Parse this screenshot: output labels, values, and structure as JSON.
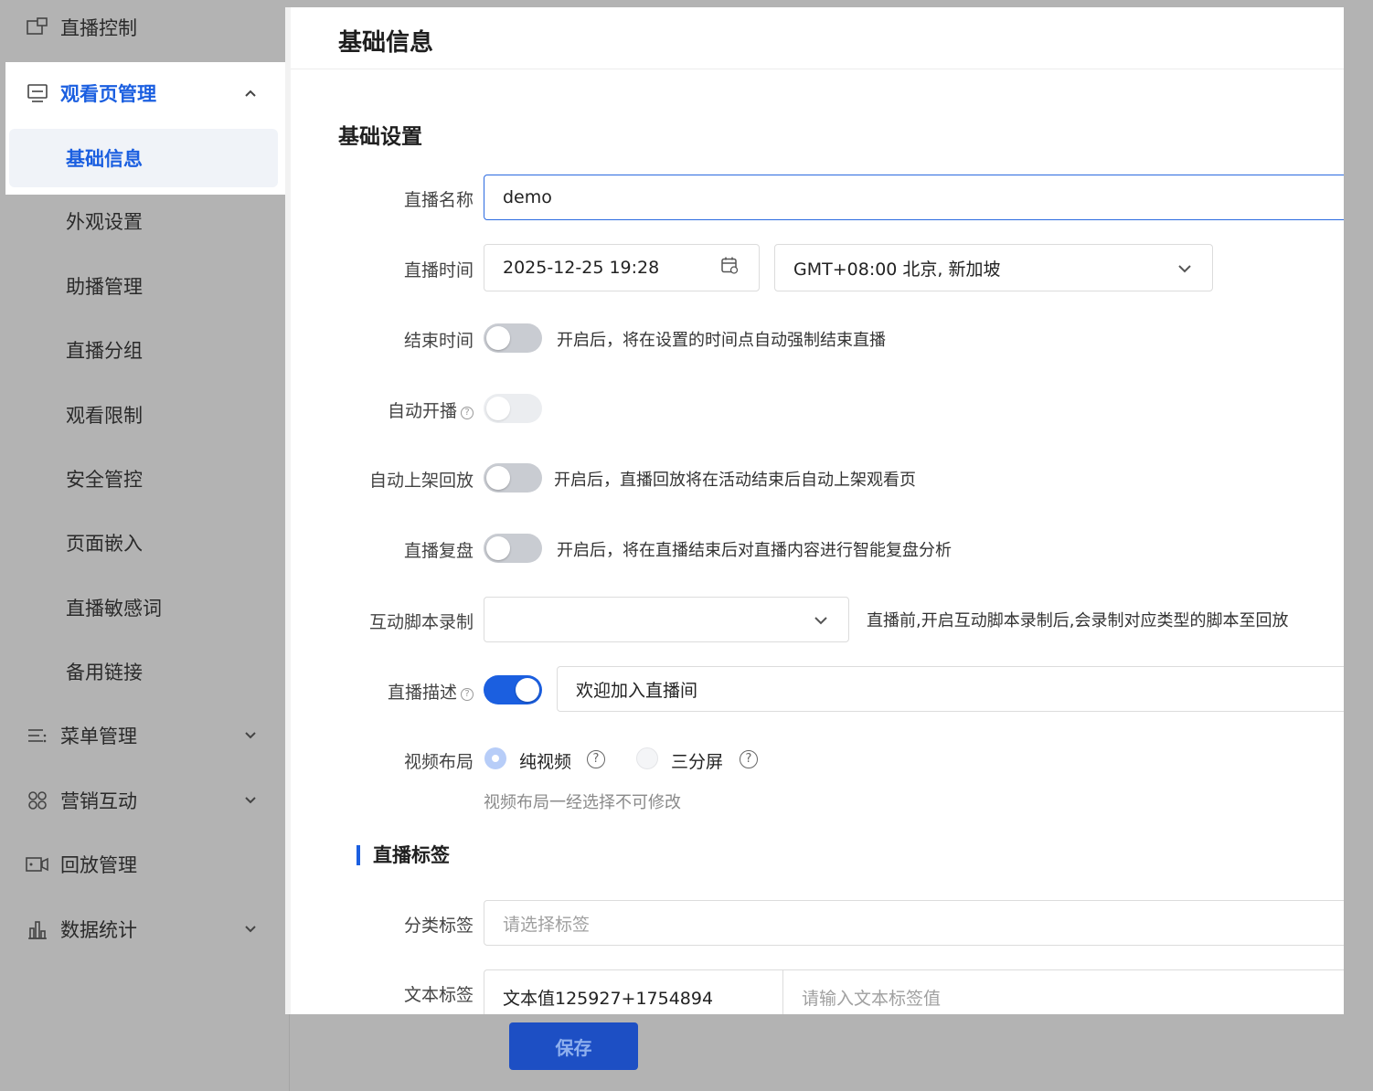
{
  "sidebar": {
    "live_control": "直播控制",
    "watch_page": "观看页管理",
    "sub_items": [
      "基础信息",
      "外观设置",
      "助播管理",
      "直播分组",
      "观看限制",
      "安全管控",
      "页面嵌入",
      "直播敏感词",
      "备用链接"
    ],
    "menu_mgmt": "菜单管理",
    "marketing": "营销互动",
    "replay": "回放管理",
    "stats": "数据统计"
  },
  "page": {
    "title": "基础信息",
    "section": "基础设置",
    "tags_section": "直播标签",
    "save": "保存"
  },
  "form": {
    "name_label": "直播名称",
    "name_value": "demo",
    "time_label": "直播时间",
    "time_value": "2025-12-25 19:28",
    "timezone_value": "GMT+08:00 北京, 新加坡",
    "end_label": "结束时间",
    "end_hint": "开启后，将在设置的时间点自动强制结束直播",
    "auto_start_label": "自动开播",
    "auto_replay_label": "自动上架回放",
    "auto_replay_hint": "开启后，直播回放将在活动结束后自动上架观看页",
    "review_label": "直播复盘",
    "review_hint": "开启后，将在直播结束后对直播内容进行智能复盘分析",
    "script_label": "互动脚本录制",
    "script_hint": "直播前,开启互动脚本录制后,会录制对应类型的脚本至回放",
    "desc_label": "直播描述",
    "desc_value": "欢迎加入直播间",
    "layout_label": "视频布局",
    "layout_option_1": "纯视频",
    "layout_option_2": "三分屏",
    "layout_hint": "视频布局一经选择不可修改",
    "category_label": "分类标签",
    "category_placeholder": "请选择标签",
    "text_tag_label": "文本标签",
    "text_tag_value": "文本值125927+1754894",
    "text_tag_placeholder": "请输入文本标签值"
  },
  "toggles": {
    "end_time": false,
    "auto_start": false,
    "auto_replay": false,
    "review": false,
    "description": true
  },
  "colors": {
    "accent": "#1b5fe0",
    "overlay": "#b3b3b3",
    "save_button": "#1d4fc4"
  }
}
